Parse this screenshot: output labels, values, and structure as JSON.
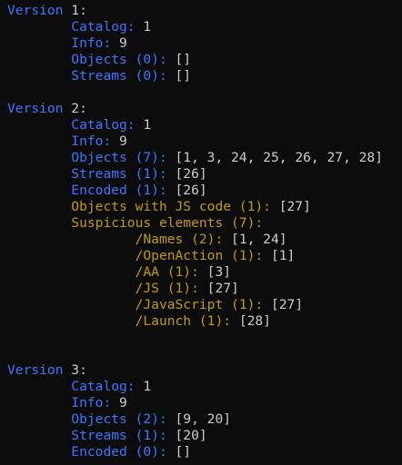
{
  "colors": {
    "blue": "#3b78ff",
    "yellow": "#c19c00",
    "white": "#cccccc",
    "background": "#0c0c0c"
  },
  "lines": [
    {
      "indent": 0,
      "parts": [
        {
          "t": "Version",
          "c": "blue"
        },
        {
          "t": " 1:",
          "c": "white"
        }
      ]
    },
    {
      "indent": 8,
      "parts": [
        {
          "t": "Catalog:",
          "c": "blue"
        },
        {
          "t": " 1",
          "c": "white"
        }
      ]
    },
    {
      "indent": 8,
      "parts": [
        {
          "t": "Info:",
          "c": "blue"
        },
        {
          "t": " 9",
          "c": "white"
        }
      ]
    },
    {
      "indent": 8,
      "parts": [
        {
          "t": "Objects (0):",
          "c": "blue"
        },
        {
          "t": " []",
          "c": "white"
        }
      ]
    },
    {
      "indent": 8,
      "parts": [
        {
          "t": "Streams (0):",
          "c": "blue"
        },
        {
          "t": " []",
          "c": "white"
        }
      ]
    },
    {
      "indent": 0,
      "parts": []
    },
    {
      "indent": 0,
      "parts": [
        {
          "t": "Version",
          "c": "blue"
        },
        {
          "t": " 2:",
          "c": "white"
        }
      ]
    },
    {
      "indent": 8,
      "parts": [
        {
          "t": "Catalog:",
          "c": "blue"
        },
        {
          "t": " 1",
          "c": "white"
        }
      ]
    },
    {
      "indent": 8,
      "parts": [
        {
          "t": "Info:",
          "c": "blue"
        },
        {
          "t": " 9",
          "c": "white"
        }
      ]
    },
    {
      "indent": 8,
      "parts": [
        {
          "t": "Objects (7):",
          "c": "blue"
        },
        {
          "t": " [1, 3, 24, 25, 26, 27, 28]",
          "c": "white"
        }
      ]
    },
    {
      "indent": 8,
      "parts": [
        {
          "t": "Streams (1):",
          "c": "blue"
        },
        {
          "t": " [26]",
          "c": "white"
        }
      ]
    },
    {
      "indent": 8,
      "parts": [
        {
          "t": "Encoded (1):",
          "c": "blue"
        },
        {
          "t": " [26]",
          "c": "white"
        }
      ]
    },
    {
      "indent": 8,
      "parts": [
        {
          "t": "Objects with JS code (1):",
          "c": "yellow"
        },
        {
          "t": " [27]",
          "c": "white"
        }
      ]
    },
    {
      "indent": 8,
      "parts": [
        {
          "t": "Suspicious elements (7):",
          "c": "yellow"
        }
      ]
    },
    {
      "indent": 16,
      "parts": [
        {
          "t": "/Names (2):",
          "c": "yellow"
        },
        {
          "t": " [1, 24]",
          "c": "white"
        }
      ]
    },
    {
      "indent": 16,
      "parts": [
        {
          "t": "/OpenAction (1):",
          "c": "yellow"
        },
        {
          "t": " [1]",
          "c": "white"
        }
      ]
    },
    {
      "indent": 16,
      "parts": [
        {
          "t": "/AA (1):",
          "c": "yellow"
        },
        {
          "t": " [3]",
          "c": "white"
        }
      ]
    },
    {
      "indent": 16,
      "parts": [
        {
          "t": "/JS (1):",
          "c": "yellow"
        },
        {
          "t": " [27]",
          "c": "white"
        }
      ]
    },
    {
      "indent": 16,
      "parts": [
        {
          "t": "/JavaScript (1):",
          "c": "yellow"
        },
        {
          "t": " [27]",
          "c": "white"
        }
      ]
    },
    {
      "indent": 16,
      "parts": [
        {
          "t": "/Launch (1):",
          "c": "yellow"
        },
        {
          "t": " [28]",
          "c": "white"
        }
      ]
    },
    {
      "indent": 0,
      "parts": []
    },
    {
      "indent": 0,
      "parts": []
    },
    {
      "indent": 0,
      "parts": [
        {
          "t": "Version",
          "c": "blue"
        },
        {
          "t": " 3:",
          "c": "white"
        }
      ]
    },
    {
      "indent": 8,
      "parts": [
        {
          "t": "Catalog:",
          "c": "blue"
        },
        {
          "t": " 1",
          "c": "white"
        }
      ]
    },
    {
      "indent": 8,
      "parts": [
        {
          "t": "Info:",
          "c": "blue"
        },
        {
          "t": " 9",
          "c": "white"
        }
      ]
    },
    {
      "indent": 8,
      "parts": [
        {
          "t": "Objects (2):",
          "c": "blue"
        },
        {
          "t": " [9, 20]",
          "c": "white"
        }
      ]
    },
    {
      "indent": 8,
      "parts": [
        {
          "t": "Streams (1):",
          "c": "blue"
        },
        {
          "t": " [20]",
          "c": "white"
        }
      ]
    },
    {
      "indent": 8,
      "parts": [
        {
          "t": "Encoded (0):",
          "c": "blue"
        },
        {
          "t": " []",
          "c": "white"
        }
      ]
    }
  ]
}
